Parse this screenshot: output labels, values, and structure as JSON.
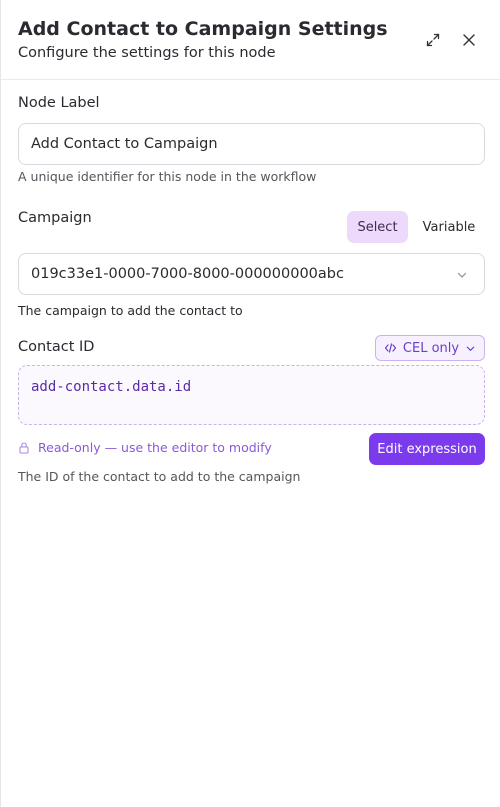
{
  "header": {
    "title": "Add Contact to Campaign Settings",
    "subtitle": "Configure the settings for this node",
    "expand_icon": "expand-icon",
    "close_icon": "close-icon"
  },
  "node_label": {
    "label": "Node Label",
    "value": "Add Contact to Campaign",
    "help": "A unique identifier for this node in the workflow"
  },
  "campaign": {
    "label": "Campaign",
    "mode_options": [
      "Select",
      "Variable"
    ],
    "selected_mode": "Select",
    "value": "019c33e1-0000-7000-8000-000000000abc",
    "help": "The campaign to add the contact to"
  },
  "contact_id": {
    "label": "Contact ID",
    "badge": "CEL only",
    "expression": "add-contact.data.id",
    "readonly_note": "Read-only — use the editor to modify",
    "edit_button": "Edit expression",
    "help": "The ID of the contact to add to the campaign"
  },
  "colors": {
    "accent": "#7c3aed",
    "accent_light": "#ecd9fb",
    "text": "#2a2a30"
  }
}
